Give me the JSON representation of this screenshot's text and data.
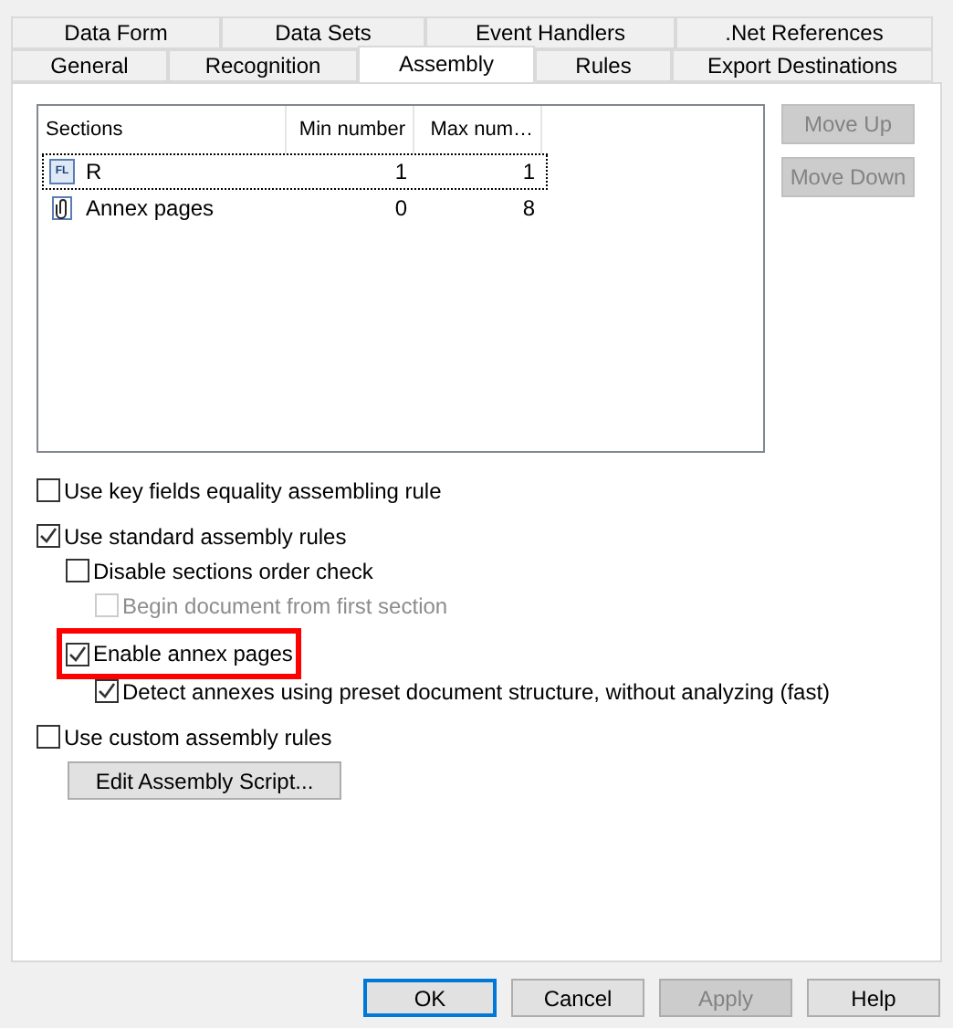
{
  "tab_rows": [
    [
      {
        "label": "Data Form",
        "selected": false
      },
      {
        "label": "Data Sets",
        "selected": false
      },
      {
        "label": "Event Handlers",
        "selected": false
      },
      {
        "label": ".Net References",
        "selected": false
      }
    ],
    [
      {
        "label": "General",
        "selected": false
      },
      {
        "label": "Recognition",
        "selected": false
      },
      {
        "label": "Assembly",
        "selected": true
      },
      {
        "label": "Rules",
        "selected": false
      },
      {
        "label": "Export Destinations",
        "selected": false
      }
    ]
  ],
  "sections_table": {
    "columns": [
      "Sections",
      "Min number",
      "Max num…"
    ],
    "rows": [
      {
        "kind": "form",
        "icon_label": "FL",
        "name": "R",
        "min": "1",
        "max": "1",
        "focused": true
      },
      {
        "kind": "annex",
        "name": "Annex pages",
        "min": "0",
        "max": "8",
        "focused": false
      }
    ]
  },
  "side_buttons": [
    {
      "label": "Move Up",
      "disabled": true
    },
    {
      "label": "Move Down",
      "disabled": true
    }
  ],
  "options": [
    {
      "label": "Use key fields equality assembling rule",
      "checked": false,
      "disabled": false,
      "highlighted": false
    },
    {
      "label": "Use standard assembly rules",
      "checked": true,
      "disabled": false,
      "highlighted": false,
      "children": [
        {
          "label": "Disable sections order check",
          "checked": false,
          "disabled": false,
          "highlighted": false,
          "children": [
            {
              "label": "Begin document from first section",
              "checked": false,
              "disabled": true,
              "highlighted": false
            }
          ]
        },
        {
          "label": "Enable annex pages",
          "checked": true,
          "disabled": false,
          "highlighted": true,
          "children": [
            {
              "label": "Detect annexes using preset document structure, without analyzing (fast)",
              "checked": true,
              "disabled": false,
              "highlighted": false
            }
          ]
        }
      ]
    },
    {
      "label": "Use custom assembly rules",
      "checked": false,
      "disabled": false,
      "highlighted": false
    }
  ],
  "script_button": {
    "label": "Edit Assembly Script..."
  },
  "dialog_buttons": [
    {
      "label": "OK",
      "default": true,
      "disabled": false
    },
    {
      "label": "Cancel",
      "default": false,
      "disabled": false
    },
    {
      "label": "Apply",
      "default": false,
      "disabled": true
    },
    {
      "label": "Help",
      "default": false,
      "disabled": false
    }
  ]
}
